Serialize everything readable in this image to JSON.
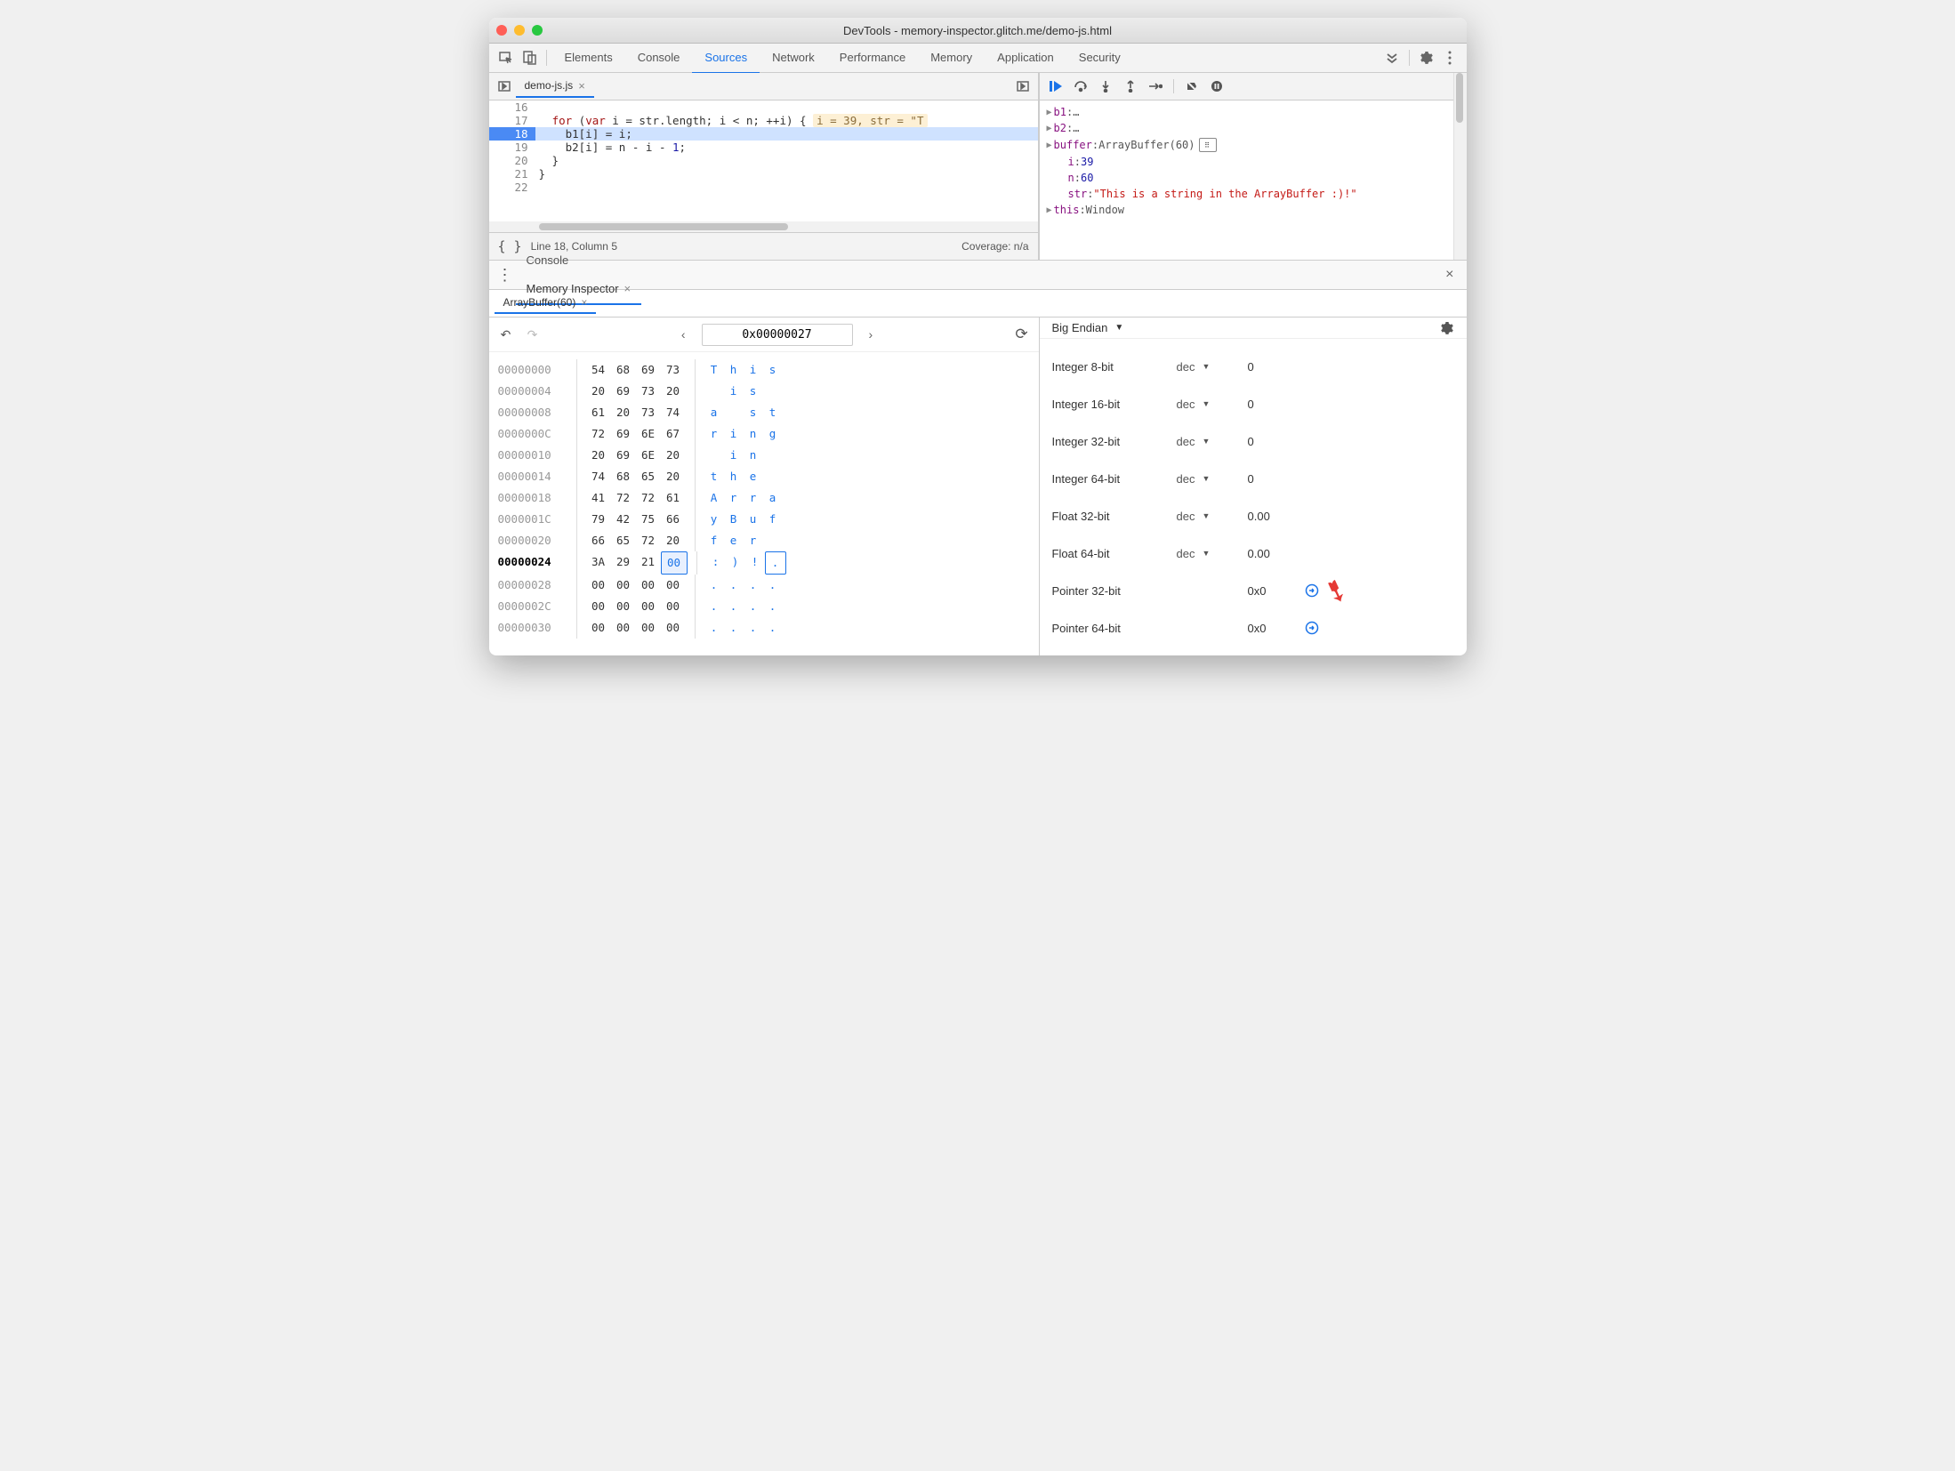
{
  "window": {
    "title": "DevTools - memory-inspector.glitch.me/demo-js.html"
  },
  "mainTabs": [
    "Elements",
    "Console",
    "Sources",
    "Network",
    "Performance",
    "Memory",
    "Application",
    "Security"
  ],
  "activeMainTab": "Sources",
  "file": {
    "name": "demo-js.js"
  },
  "code": {
    "lines": [
      {
        "n": 16,
        "text": ""
      },
      {
        "n": 17,
        "text": "  for (var i = str.length; i < n; ++i) {",
        "inline": "i = 39, str = \"T"
      },
      {
        "n": 18,
        "text": "    b1[i] = i;",
        "hl": true
      },
      {
        "n": 19,
        "text": "    b2[i] = n - i - 1;"
      },
      {
        "n": 20,
        "text": "  }"
      },
      {
        "n": 21,
        "text": "}"
      },
      {
        "n": 22,
        "text": ""
      }
    ]
  },
  "status": {
    "pos": "Line 18, Column 5",
    "coverage": "Coverage: n/a"
  },
  "scope": {
    "rows": [
      {
        "k": "b1",
        "v": "…",
        "exp": true
      },
      {
        "k": "b2",
        "v": "…",
        "exp": true
      },
      {
        "k": "buffer",
        "v": "ArrayBuffer(60)",
        "exp": true,
        "chip": true
      },
      {
        "k": "i",
        "v": "39",
        "num": true,
        "indent": true
      },
      {
        "k": "n",
        "v": "60",
        "num": true,
        "indent": true
      },
      {
        "k": "str",
        "v": "\"This is a string in the ArrayBuffer :)!\"",
        "str": true,
        "indent": true
      },
      {
        "k": "this",
        "v": "Window",
        "exp": true
      }
    ]
  },
  "drawerTabs": [
    "Console",
    "Memory Inspector"
  ],
  "activeDrawerTab": "Memory Inspector",
  "memTab": "ArrayBuffer(60)",
  "hex": {
    "address": "0x00000027",
    "rows": [
      {
        "off": "00000000",
        "b": [
          "54",
          "68",
          "69",
          "73"
        ],
        "a": [
          "T",
          "h",
          "i",
          "s"
        ]
      },
      {
        "off": "00000004",
        "b": [
          "20",
          "69",
          "73",
          "20"
        ],
        "a": [
          " ",
          "i",
          "s",
          " "
        ]
      },
      {
        "off": "00000008",
        "b": [
          "61",
          "20",
          "73",
          "74"
        ],
        "a": [
          "a",
          " ",
          "s",
          "t"
        ]
      },
      {
        "off": "0000000C",
        "b": [
          "72",
          "69",
          "6E",
          "67"
        ],
        "a": [
          "r",
          "i",
          "n",
          "g"
        ]
      },
      {
        "off": "00000010",
        "b": [
          "20",
          "69",
          "6E",
          "20"
        ],
        "a": [
          " ",
          "i",
          "n",
          " "
        ]
      },
      {
        "off": "00000014",
        "b": [
          "74",
          "68",
          "65",
          "20"
        ],
        "a": [
          "t",
          "h",
          "e",
          " "
        ]
      },
      {
        "off": "00000018",
        "b": [
          "41",
          "72",
          "72",
          "61"
        ],
        "a": [
          "A",
          "r",
          "r",
          "a"
        ]
      },
      {
        "off": "0000001C",
        "b": [
          "79",
          "42",
          "75",
          "66"
        ],
        "a": [
          "y",
          "B",
          "u",
          "f"
        ]
      },
      {
        "off": "00000020",
        "b": [
          "66",
          "65",
          "72",
          "20"
        ],
        "a": [
          "f",
          "e",
          "r",
          " "
        ]
      },
      {
        "off": "00000024",
        "b": [
          "3A",
          "29",
          "21",
          "00"
        ],
        "a": [
          ":",
          ")",
          "!",
          "."
        ],
        "cur": true,
        "sel": 3
      },
      {
        "off": "00000028",
        "b": [
          "00",
          "00",
          "00",
          "00"
        ],
        "a": [
          ".",
          ".",
          ".",
          "."
        ]
      },
      {
        "off": "0000002C",
        "b": [
          "00",
          "00",
          "00",
          "00"
        ],
        "a": [
          ".",
          ".",
          ".",
          "."
        ]
      },
      {
        "off": "00000030",
        "b": [
          "00",
          "00",
          "00",
          "00"
        ],
        "a": [
          ".",
          ".",
          ".",
          "."
        ]
      }
    ]
  },
  "valuePane": {
    "endian": "Big Endian",
    "rows": [
      {
        "label": "Integer 8-bit",
        "mode": "dec",
        "val": "0"
      },
      {
        "label": "Integer 16-bit",
        "mode": "dec",
        "val": "0"
      },
      {
        "label": "Integer 32-bit",
        "mode": "dec",
        "val": "0"
      },
      {
        "label": "Integer 64-bit",
        "mode": "dec",
        "val": "0"
      },
      {
        "label": "Float 32-bit",
        "mode": "dec",
        "val": "0.00"
      },
      {
        "label": "Float 64-bit",
        "mode": "dec",
        "val": "0.00"
      },
      {
        "label": "Pointer 32-bit",
        "mode": "",
        "val": "0x0",
        "jump": true,
        "arrow": true
      },
      {
        "label": "Pointer 64-bit",
        "mode": "",
        "val": "0x0",
        "jump": true
      }
    ]
  }
}
